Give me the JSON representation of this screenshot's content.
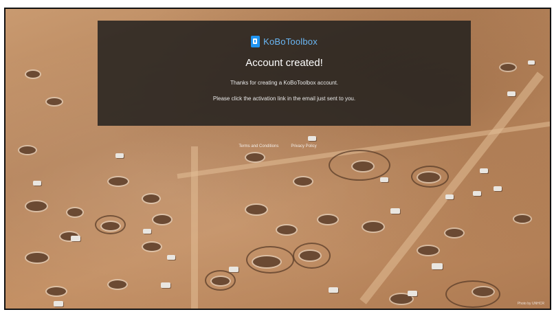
{
  "brand": {
    "logo_text": "KoBoToolbox",
    "logo_icon": "kobo-logo-icon",
    "accent_color": "#2095f3"
  },
  "panel": {
    "title": "Account created!",
    "message_1": "Thanks for creating a KoBoToolbox account.",
    "message_2": "Please click the activation link in the email just sent to you."
  },
  "footer": {
    "terms_label": "Terms and Conditions",
    "privacy_label": "Privacy Policy",
    "photo_credit": "Photo by UNHCR"
  }
}
